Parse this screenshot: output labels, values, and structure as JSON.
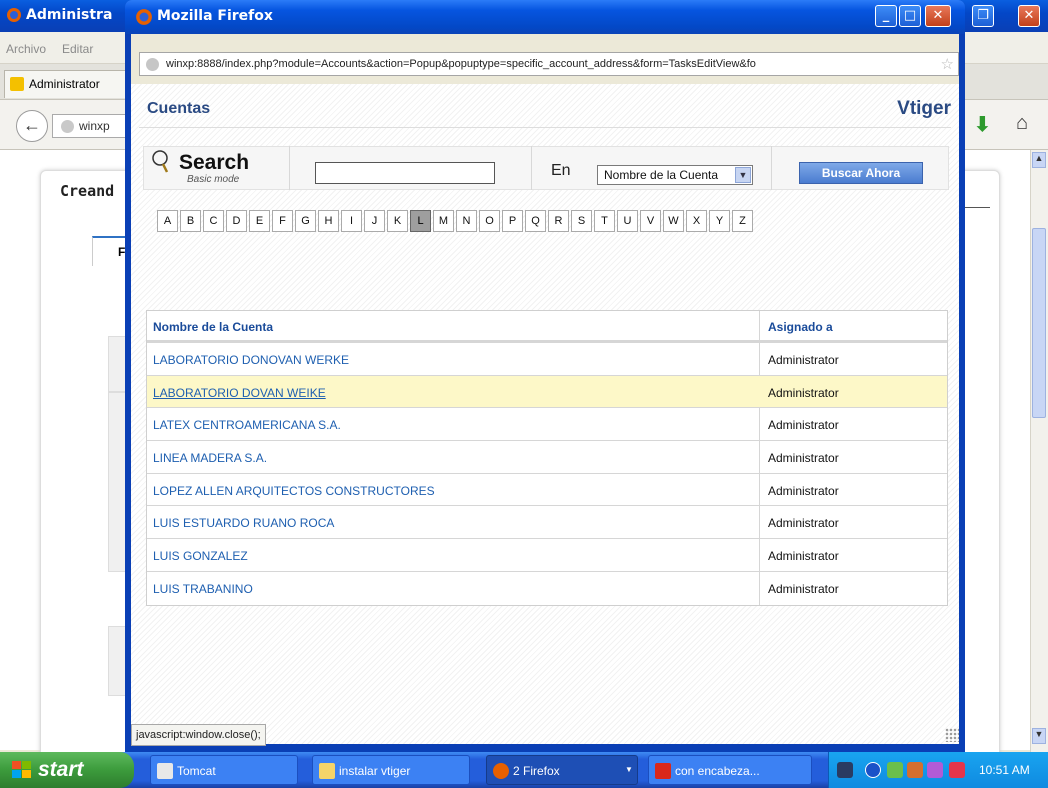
{
  "background_window": {
    "title": "Administra",
    "menu": [
      "Archivo",
      "Editar"
    ],
    "tab_label": "Administrator",
    "url_short": "winxp",
    "page_heading": "Creand",
    "tab_char": "F"
  },
  "popup": {
    "title": "Mozilla Firefox",
    "url": "winxp:8888/index.php?module=Accounts&action=Popup&popuptype=specific_account_address&form=TasksEditView&fo",
    "module_title": "Cuentas",
    "brand": "Vtiger",
    "search": {
      "title": "Search",
      "mode": "Basic mode",
      "input_value": "",
      "in_label": "En",
      "field_selected": "Nombre de la Cuenta",
      "button_label": "Buscar Ahora"
    },
    "alphabet": [
      "A",
      "B",
      "C",
      "D",
      "E",
      "F",
      "G",
      "H",
      "I",
      "J",
      "K",
      "L",
      "M",
      "N",
      "O",
      "P",
      "Q",
      "R",
      "S",
      "T",
      "U",
      "V",
      "W",
      "X",
      "Y",
      "Z"
    ],
    "active_letter": "L",
    "table": {
      "headers": [
        "Nombre de la Cuenta",
        "Asignado a"
      ],
      "rows": [
        {
          "name": "LABORATORIO DONOVAN WERKE",
          "assigned": "Administrator"
        },
        {
          "name": "LABORATORIO DOVAN WEIKE",
          "assigned": "Administrator"
        },
        {
          "name": "LATEX CENTROAMERICANA S.A.",
          "assigned": "Administrator"
        },
        {
          "name": "LINEA MADERA S.A.",
          "assigned": "Administrator"
        },
        {
          "name": "LOPEZ ALLEN ARQUITECTOS CONSTRUCTORES",
          "assigned": "Administrator"
        },
        {
          "name": "LUIS ESTUARDO RUANO ROCA",
          "assigned": "Administrator"
        },
        {
          "name": "LUIS GONZALEZ",
          "assigned": "Administrator"
        },
        {
          "name": "LUIS TRABANINO",
          "assigned": "Administrator"
        }
      ],
      "highlighted_row": 1
    },
    "status_text": "javascript:window.close();"
  },
  "taskbar": {
    "start_label": "start",
    "tasks": [
      {
        "label": "Tomcat",
        "icon": "tomcat-icon"
      },
      {
        "label": "instalar vtiger",
        "icon": "folder-icon"
      },
      {
        "label": "2 Firefox",
        "icon": "firefox-icon"
      },
      {
        "label": "con encabeza...",
        "icon": "pdf-icon"
      }
    ],
    "clock": "10:51 AM"
  },
  "colors": {
    "xp_blue": "#0a3fb5",
    "link_blue": "#1e5fb0",
    "highlight_row": "#fdf8c8",
    "start_green": "#3c9b3c"
  }
}
